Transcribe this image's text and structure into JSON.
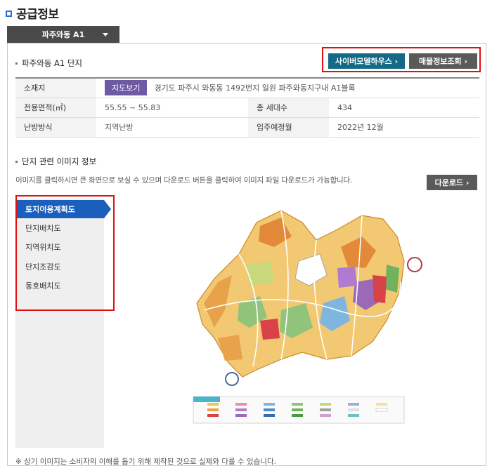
{
  "page": {
    "title": "공급정보"
  },
  "selector": {
    "value": "파주와동 A1"
  },
  "complex": {
    "title": "파주와동 A1 단지",
    "cyber_button": "사이버모델하우스 ›",
    "sales_button": "매물정보조회  ›",
    "table": {
      "location_label": "소재지",
      "map_button": "지도보기",
      "location_value": "경기도 파주시 와동동 1492번지 일원 파주와동지구내 A1블록",
      "area_label": "전용면적(㎡)",
      "area_value": "55.55 ~ 55.83",
      "households_label": "총 세대수",
      "households_value": "434",
      "heating_label": "난방방식",
      "heating_value": "지역난방",
      "movein_label": "입주예정월",
      "movein_value": "2022년 12월"
    }
  },
  "images": {
    "title": "단지 관련 이미지 정보",
    "description": "이미지를 클릭하시면 큰 화면으로 보실 수 있으며 다운로드 버튼을 클릭하여 이미지 파일 다운로드가 가능합니다.",
    "download_button": "다운로드 ›",
    "tabs": [
      "토지이용계획도",
      "단지배치도",
      "지역위치도",
      "단지조감도",
      "동호배치도"
    ],
    "active_tab": 0
  },
  "footer": {
    "note": "※ 상기 이미지는 소비자의 이해를 돕기 위해 제작된 것으로 실제와 다를 수 있습니다."
  },
  "colors": {
    "accent_blue": "#1b5fbd",
    "cyber_teal": "#146a86",
    "map_purple": "#6e5aa3",
    "highlight_red": "#e01010"
  }
}
